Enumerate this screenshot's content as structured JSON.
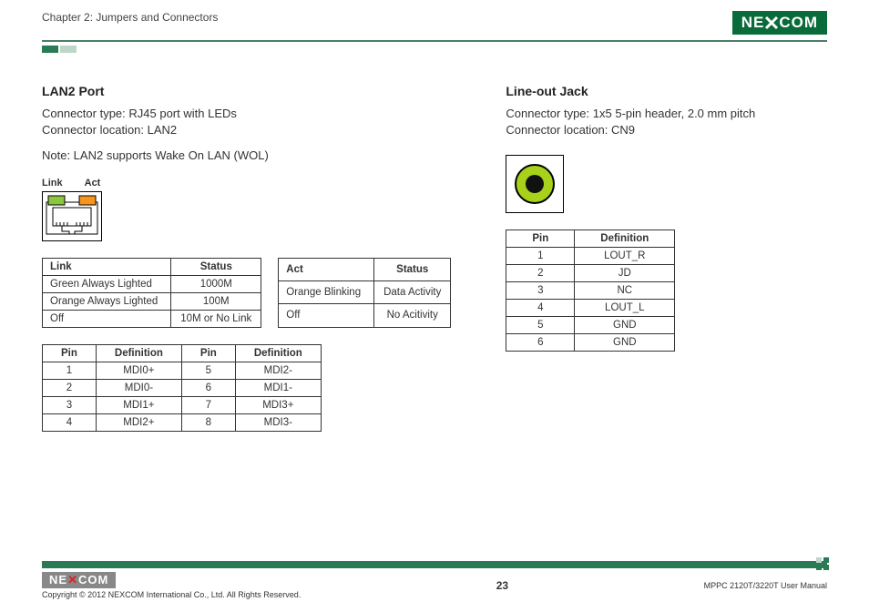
{
  "header": {
    "chapter": "Chapter 2: Jumpers and Connectors",
    "logo_text": "NEXCOM"
  },
  "lan2": {
    "title": "LAN2 Port",
    "type_line": "Connector type: RJ45 port with LEDs",
    "loc_line": "Connector location: LAN2",
    "note": "Note: LAN2 supports Wake On LAN (WOL)",
    "label_link": "Link",
    "label_act": "Act",
    "link_table": {
      "headers": [
        "Link",
        "Status"
      ],
      "rows": [
        [
          "Green Always Lighted",
          "1000M"
        ],
        [
          "Orange Always Lighted",
          "100M"
        ],
        [
          "Off",
          "10M or No Link"
        ]
      ]
    },
    "act_table": {
      "headers": [
        "Act",
        "Status"
      ],
      "rows": [
        [
          "Orange Blinking",
          "Data Activity"
        ],
        [
          "Off",
          "No Acitivity"
        ]
      ]
    },
    "pin_table": {
      "headers": [
        "Pin",
        "Definition",
        "Pin",
        "Definition"
      ],
      "rows": [
        [
          "1",
          "MDI0+",
          "5",
          "MDI2-"
        ],
        [
          "2",
          "MDI0-",
          "6",
          "MDI1-"
        ],
        [
          "3",
          "MDI1+",
          "7",
          "MDI3+"
        ],
        [
          "4",
          "MDI2+",
          "8",
          "MDI3-"
        ]
      ]
    }
  },
  "lineout": {
    "title": "Line-out Jack",
    "type_line": "Connector type: 1x5 5-pin header, 2.0 mm pitch",
    "loc_line": "Connector location: CN9",
    "pin_table": {
      "headers": [
        "Pin",
        "Definition"
      ],
      "rows": [
        [
          "1",
          "LOUT_R"
        ],
        [
          "2",
          "JD"
        ],
        [
          "3",
          "NC"
        ],
        [
          "4",
          "LOUT_L"
        ],
        [
          "5",
          "GND"
        ],
        [
          "6",
          "GND"
        ]
      ]
    }
  },
  "footer": {
    "logo_text": "NEXCOM",
    "copyright": "Copyright © 2012 NEXCOM International Co., Ltd. All Rights Reserved.",
    "page": "23",
    "doc": "MPPC 2120T/3220T User Manual"
  }
}
